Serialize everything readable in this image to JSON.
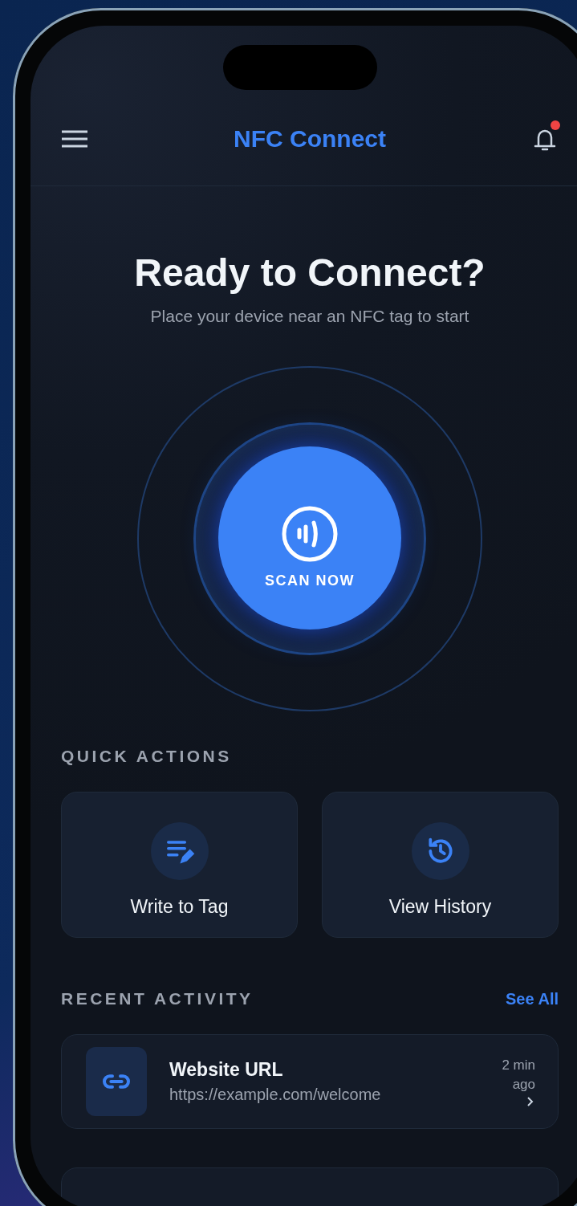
{
  "header": {
    "title": "NFC Connect",
    "notifications_unread": true
  },
  "hero": {
    "title": "Ready to Connect?",
    "subtitle": "Place your device near an NFC tag to start"
  },
  "scan_button": {
    "label": "SCAN NOW"
  },
  "quick_actions": {
    "heading": "QUICK ACTIONS",
    "items": [
      {
        "kind": "write",
        "label": "Write to Tag"
      },
      {
        "kind": "history",
        "label": "View History"
      }
    ]
  },
  "recent_activity": {
    "heading": "RECENT ACTIVITY",
    "link": "See All",
    "items": [
      {
        "kind": "url",
        "title": "Website URL",
        "detail": "https://example.com/welcome",
        "time": "2 min ago"
      }
    ]
  }
}
